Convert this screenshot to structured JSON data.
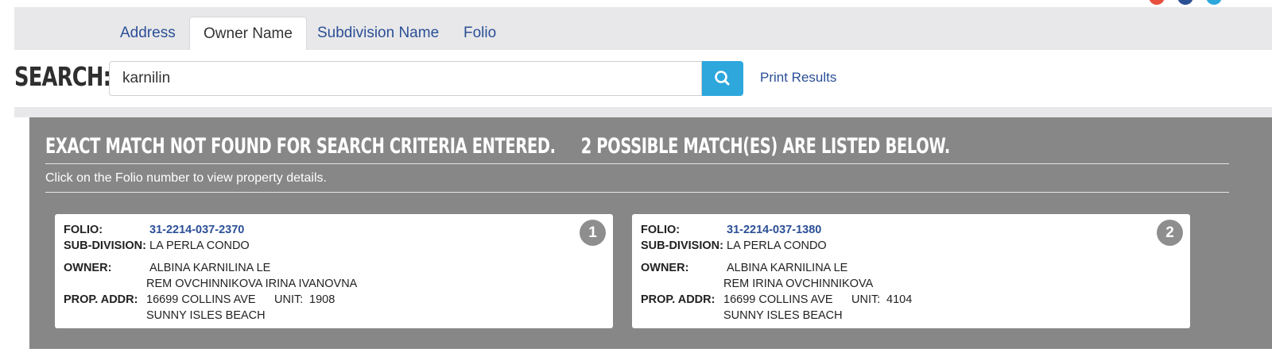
{
  "top_icons": [
    {
      "name": "social-icon-red",
      "color": "#e8503d"
    },
    {
      "name": "social-icon-navy",
      "color": "#2c4f94"
    },
    {
      "name": "social-icon-teal",
      "color": "#2ea7dd"
    }
  ],
  "tabs": [
    {
      "label": "Address",
      "active": false
    },
    {
      "label": "Owner Name",
      "active": true
    },
    {
      "label": "Subdivision Name",
      "active": false
    },
    {
      "label": "Folio",
      "active": false
    }
  ],
  "search": {
    "label": "SEARCH:",
    "value": "karnilin",
    "button_icon": "search-icon",
    "print_label": "Print Results"
  },
  "results": {
    "title": "EXACT MATCH NOT FOUND FOR SEARCH CRITERIA ENTERED.     2 POSSIBLE MATCH(ES) ARE LISTED BELOW.",
    "subtitle": "Click on the Folio number to view property details.",
    "cards": [
      {
        "number": "1",
        "folio_label": "FOLIO:",
        "folio": "31-2214-037-2370",
        "subdivision_label": "SUB-DIVISION:",
        "subdivision": "LA PERLA CONDO",
        "owner_label": "OWNER:",
        "owner_line1": "ALBINA KARNILINA LE",
        "owner_line2": "REM OVCHINNIKOVA IRINA IVANOVNA",
        "addr_label": "PROP. ADDR:",
        "addr_line1": "16699 COLLINS AVE",
        "unit_label": "UNIT:",
        "unit": "1908",
        "addr_line2": "SUNNY ISLES BEACH"
      },
      {
        "number": "2",
        "folio_label": "FOLIO:",
        "folio": "31-2214-037-1380",
        "subdivision_label": "SUB-DIVISION:",
        "subdivision": "LA PERLA CONDO",
        "owner_label": "OWNER:",
        "owner_line1": "ALBINA KARNILINA LE",
        "owner_line2": "REM IRINA OVCHINNIKOVA",
        "addr_label": "PROP. ADDR:",
        "addr_line1": "16699 COLLINS AVE",
        "unit_label": "UNIT:",
        "unit": "4104",
        "addr_line2": "SUNNY ISLES BEACH"
      }
    ]
  }
}
